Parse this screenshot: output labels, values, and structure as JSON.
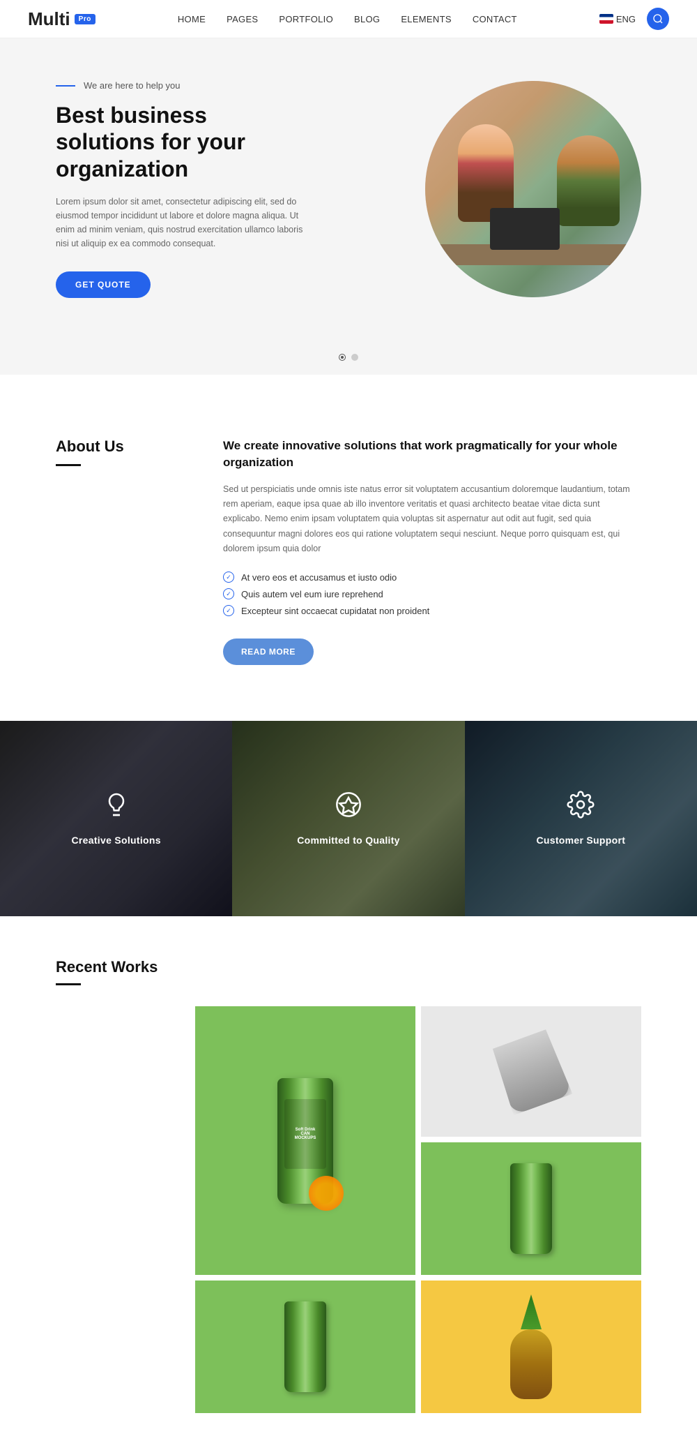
{
  "header": {
    "logo": "Multi",
    "pro_badge": "Pro",
    "nav": {
      "items": [
        {
          "label": "HOME",
          "active": false
        },
        {
          "label": "PAGES",
          "active": false
        },
        {
          "label": "PORTFOLIO",
          "active": false
        },
        {
          "label": "BLOG",
          "active": false
        },
        {
          "label": "ELEMENTS",
          "active": false
        },
        {
          "label": "CONTACT",
          "active": false
        }
      ]
    },
    "lang": "ENG",
    "search_title": "Search"
  },
  "hero": {
    "tag": "We are here to help you",
    "title": "Best business solutions for your organization",
    "body": "Lorem ipsum dolor sit amet, consectetur adipiscing elit, sed do eiusmod tempor incididunt ut labore et dolore magna aliqua. Ut enim ad minim veniam, quis nostrud exercitation ullamco laboris nisi ut aliquip ex ea commodo consequat.",
    "cta": "GET QUOTE"
  },
  "about": {
    "title": "About Us",
    "headline": "We create innovative solutions that work pragmatically for your whole organization",
    "body": "Sed ut perspiciatis unde omnis iste natus error sit voluptatem accusantium doloremque laudantium, totam rem aperiam, eaque ipsa quae ab illo inventore veritatis et quasi architecto beatae vitae dicta sunt explicabo. Nemo enim ipsam voluptatem quia voluptas sit aspernatur aut odit aut fugit, sed quia consequuntur magni dolores eos qui ratione voluptatem sequi nesciunt. Neque porro quisquam est, qui dolorem ipsum quia dolor",
    "checklist": [
      "At vero eos et accusamus et iusto odio",
      "Quis autem vel eum iure reprehend",
      "Excepteur sint occaecat cupidatat non proident"
    ],
    "read_more": "READ MORE"
  },
  "panels": [
    {
      "id": "creative",
      "label": "Creative Solutions",
      "icon": "bulb"
    },
    {
      "id": "quality",
      "label": "Committed to Quality",
      "icon": "star"
    },
    {
      "id": "support",
      "label": "Customer Support",
      "icon": "gear"
    }
  ],
  "recent_works": {
    "title": "Recent Works",
    "items": [
      {
        "id": "can1",
        "type": "green-can",
        "tall": true
      },
      {
        "id": "cup",
        "type": "gray-cup"
      },
      {
        "id": "can2",
        "type": "green-can-2"
      },
      {
        "id": "pineapple",
        "type": "yellow-pineapple"
      }
    ]
  },
  "carousel": {
    "dots": [
      {
        "active": true
      },
      {
        "active": false
      }
    ]
  }
}
